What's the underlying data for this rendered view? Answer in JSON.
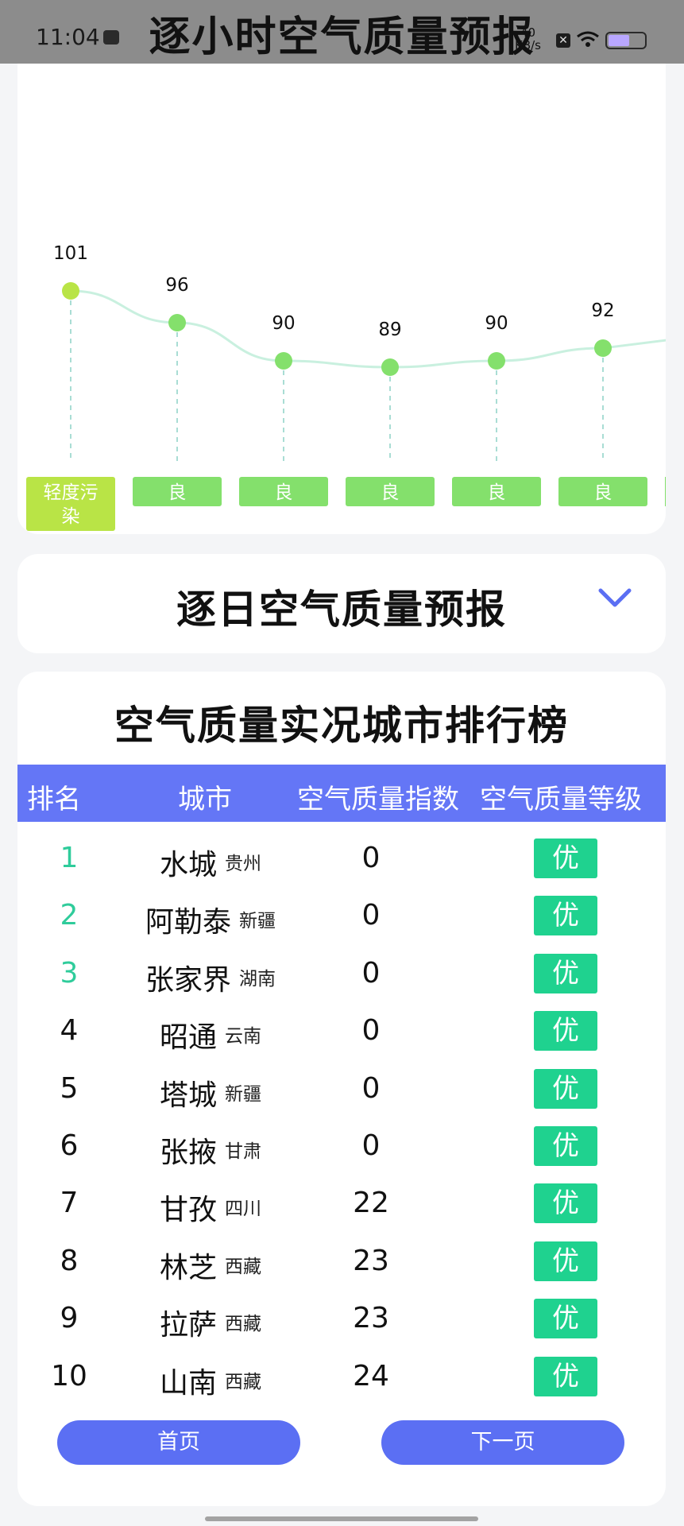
{
  "status": {
    "time": "11:04",
    "speed_value": "40",
    "speed_unit": "KB/s",
    "battery_color": "#b9a7ff"
  },
  "header": {
    "title": "逐小时空气质量预报"
  },
  "hourly": {
    "points": [
      {
        "value": 101,
        "level": "轻度污染",
        "color": "#b9e446"
      },
      {
        "value": 96,
        "level": "良",
        "color": "#84e06c"
      },
      {
        "value": 90,
        "level": "良",
        "color": "#84e06c"
      },
      {
        "value": 89,
        "level": "良",
        "color": "#84e06c"
      },
      {
        "value": 90,
        "level": "良",
        "color": "#84e06c"
      },
      {
        "value": 92,
        "level": "良",
        "color": "#84e06c"
      }
    ]
  },
  "daily": {
    "title": "逐日空气质量预报",
    "toggle_icon": "chevron-down-icon",
    "accent": "#5b6ff3"
  },
  "ranking": {
    "title": "空气质量实况城市排行榜",
    "headers": [
      "排名",
      "城市",
      "空气质量指数",
      "空气质量等级"
    ],
    "header_color": "#6476f6",
    "level_color": "#1fd28f",
    "rows": [
      {
        "rank": "1",
        "city": "水城",
        "province": "贵州",
        "aqi": "0",
        "level": "优"
      },
      {
        "rank": "2",
        "city": "阿勒泰",
        "province": "新疆",
        "aqi": "0",
        "level": "优"
      },
      {
        "rank": "3",
        "city": "张家界",
        "province": "湖南",
        "aqi": "0",
        "level": "优"
      },
      {
        "rank": "4",
        "city": "昭通",
        "province": "云南",
        "aqi": "0",
        "level": "优"
      },
      {
        "rank": "5",
        "city": "塔城",
        "province": "新疆",
        "aqi": "0",
        "level": "优"
      },
      {
        "rank": "6",
        "city": "张掖",
        "province": "甘肃",
        "aqi": "0",
        "level": "优"
      },
      {
        "rank": "7",
        "city": "甘孜",
        "province": "四川",
        "aqi": "22",
        "level": "优"
      },
      {
        "rank": "8",
        "city": "林芝",
        "province": "西藏",
        "aqi": "23",
        "level": "优"
      },
      {
        "rank": "9",
        "city": "拉萨",
        "province": "西藏",
        "aqi": "23",
        "level": "优"
      },
      {
        "rank": "10",
        "city": "山南",
        "province": "西藏",
        "aqi": "24",
        "level": "优"
      }
    ],
    "first_page_label": "首页",
    "next_page_label": "下一页"
  }
}
